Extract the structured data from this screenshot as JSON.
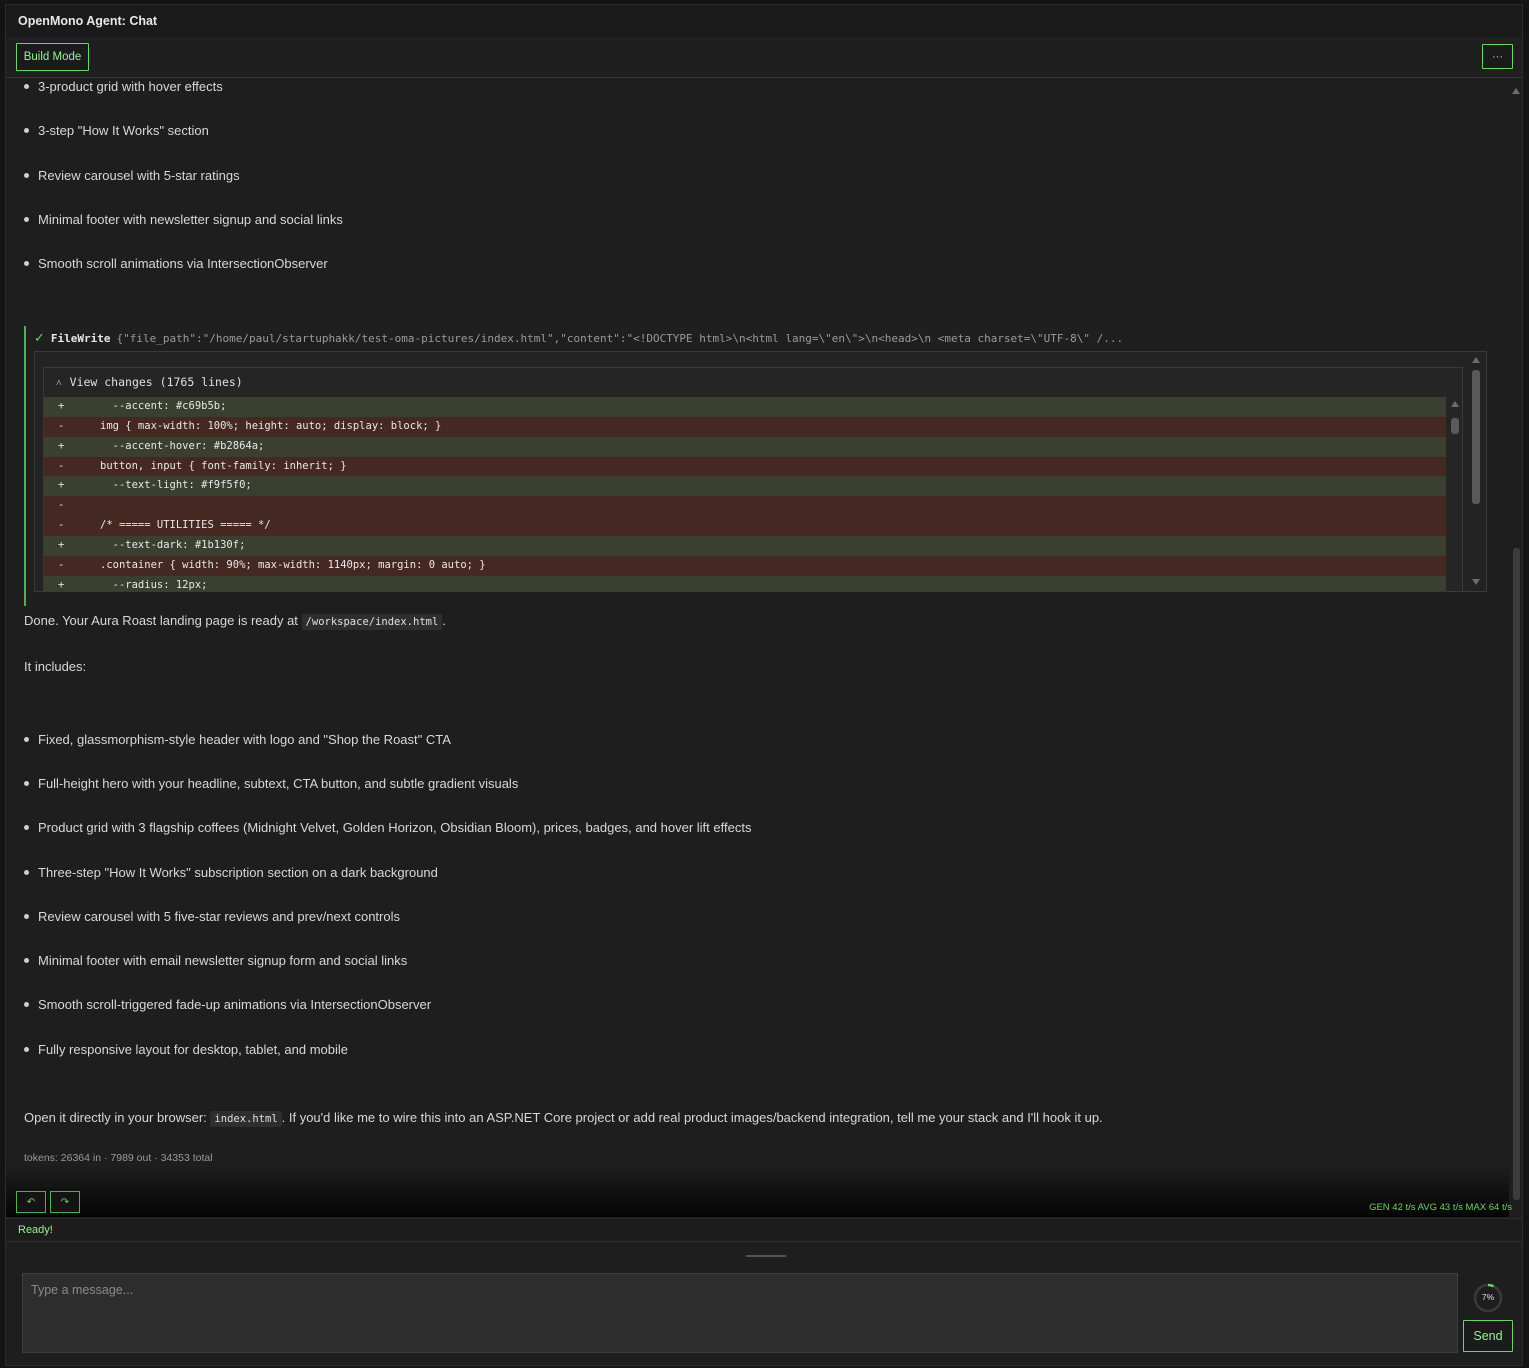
{
  "window": {
    "title": "OpenMono Agent: Chat"
  },
  "toolbar": {
    "mode_label": "Build Mode",
    "more_label": "···"
  },
  "previous_bullets": [
    "3-product grid with hover effects",
    "3-step \"How It Works\" section",
    "Review carousel with 5-star ratings",
    "Minimal footer with newsletter signup and social links",
    "Smooth scroll animations via IntersectionObserver"
  ],
  "tool_call": {
    "status_icon": "✓",
    "name": "FileWrite",
    "args": "{\"file_path\":\"/home/paul/startuphakk/test-oma-pictures/index.html\",\"content\":\"<!DOCTYPE html>\\n<html lang=\\\"en\\\">\\n<head>\\n <meta charset=\\\"UTF-8\\\" /...",
    "expander_icon": "˄",
    "diff_title": "View changes (1765 lines)",
    "diff_lines": [
      {
        "sign": "+",
        "text": "  --accent: #c69b5b;",
        "kind": "add"
      },
      {
        "sign": "-",
        "text": "img { max-width: 100%; height: auto; display: block; }",
        "kind": "del"
      },
      {
        "sign": "+",
        "text": "  --accent-hover: #b2864a;",
        "kind": "add"
      },
      {
        "sign": "-",
        "text": "button, input { font-family: inherit; }",
        "kind": "del"
      },
      {
        "sign": "+",
        "text": "  --text-light: #f9f5f0;",
        "kind": "add"
      },
      {
        "sign": "-",
        "text": "",
        "kind": "del"
      },
      {
        "sign": "-",
        "text": "/* ===== UTILITIES ===== */",
        "kind": "del"
      },
      {
        "sign": "+",
        "text": "  --text-dark: #1b130f;",
        "kind": "add"
      },
      {
        "sign": "-",
        "text": ".container { width: 90%; max-width: 1140px; margin: 0 auto; }",
        "kind": "del"
      },
      {
        "sign": "+",
        "text": "  --radius: 12px;",
        "kind": "add"
      }
    ]
  },
  "response": {
    "done_prefix": "Done. Your Aura Roast landing page is ready at",
    "done_code": "/workspace/index.html",
    "done_suffix": ".",
    "includes_label": "It includes:",
    "bullets": [
      "Fixed, glassmorphism-style header with logo and \"Shop the Roast\" CTA",
      "Full-height hero with your headline, subtext, CTA button, and subtle gradient visuals",
      "Product grid with 3 flagship coffees (Midnight Velvet, Golden Horizon, Obsidian Bloom), prices, badges, and hover lift effects",
      "Three-step \"How It Works\" subscription section on a dark background",
      "Review carousel with 5 five-star reviews and prev/next controls",
      "Minimal footer with email newsletter signup form and social links",
      "Smooth scroll-triggered fade-up animations via IntersectionObserver",
      "Fully responsive layout for desktop, tablet, and mobile"
    ],
    "open_prefix": "Open it directly in your browser:",
    "open_code": "index.html",
    "open_suffix": ". If you'd like me to wire this into an ASP.NET Core project or add real product images/backend integration, tell me your stack and I'll hook it up."
  },
  "tokens_line": "tokens: 26364 in · 7989 out · 34353 total",
  "actions": {
    "undo_icon": "undo-icon",
    "redo_icon": "redo-icon",
    "undo_glyph": "↶",
    "redo_glyph": "↷"
  },
  "rate": "GEN 42 t/s AVG 43 t/s MAX 64 t/s",
  "status": "Ready!",
  "composer": {
    "placeholder": "Type a message...",
    "context_percent": "7%",
    "context_fraction": 0.07,
    "send_label": "Send"
  },
  "colors": {
    "accent": "#6ad36a",
    "diff_add": "#3a3f30",
    "diff_del": "#452822",
    "background": "#1e1e1e"
  }
}
